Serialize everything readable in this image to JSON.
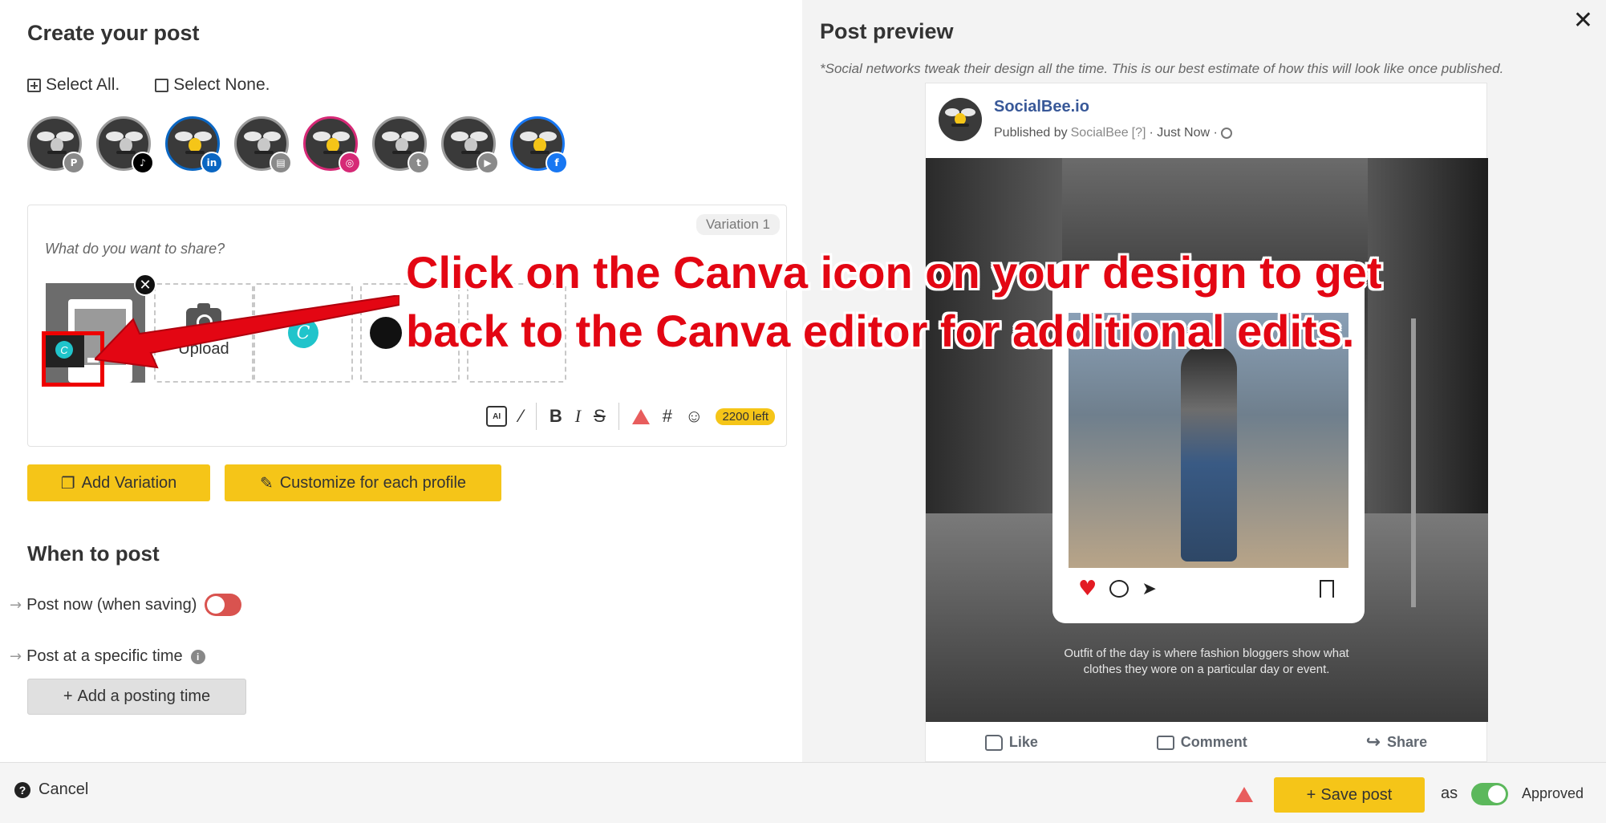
{
  "composer": {
    "title": "Create your post",
    "select_all": "Select All.",
    "select_none": "Select None.",
    "profiles": [
      {
        "network": "pinterest",
        "badge": "P",
        "color": "#8a8a8a",
        "active": false
      },
      {
        "network": "tiktok",
        "badge": "♪",
        "color": "#000000",
        "active": false
      },
      {
        "network": "linkedin",
        "badge": "in",
        "color": "#0a66c2",
        "active": true
      },
      {
        "network": "google-business",
        "badge": "▤",
        "color": "#8a8a8a",
        "active": false
      },
      {
        "network": "instagram",
        "badge": "◎",
        "color": "#d62976",
        "active": true
      },
      {
        "network": "twitter",
        "badge": "t",
        "color": "#8a8a8a",
        "active": false
      },
      {
        "network": "youtube",
        "badge": "▶",
        "color": "#8a8a8a",
        "active": false
      },
      {
        "network": "facebook",
        "badge": "f",
        "color": "#1877f2",
        "active": true
      }
    ],
    "variation_tag": "Variation 1",
    "placeholder": "What do you want to share?",
    "upload_label": "Upload",
    "char_left": "2200 left",
    "add_variation": "Add Variation",
    "customize": "Customize for each profile"
  },
  "when": {
    "title": "When to post",
    "post_now": "Post now (when saving)",
    "post_specific": "Post at a specific time",
    "add_posting_time": "Add a posting time"
  },
  "preview": {
    "title": "Post preview",
    "note": "*Social networks tweak their design all the time. This is our best estimate of how this will look like once published.",
    "page_name": "SocialBee.io",
    "published_by_prefix": "Published by",
    "published_by_name": "SocialBee",
    "help": "[?]",
    "time": "· Just Now ·",
    "caption": "Outfit of the day is where fashion bloggers show what clothes they wore on a particular day or event.",
    "like": "Like",
    "comment": "Comment",
    "share": "Share"
  },
  "bottom": {
    "cancel": "Cancel",
    "save": "Save post",
    "as": "as",
    "status": "Approved"
  },
  "annotation": {
    "text": "Click on the Canva icon on your design to get back to the Canva editor for additional edits.",
    "color": "#e30613"
  }
}
